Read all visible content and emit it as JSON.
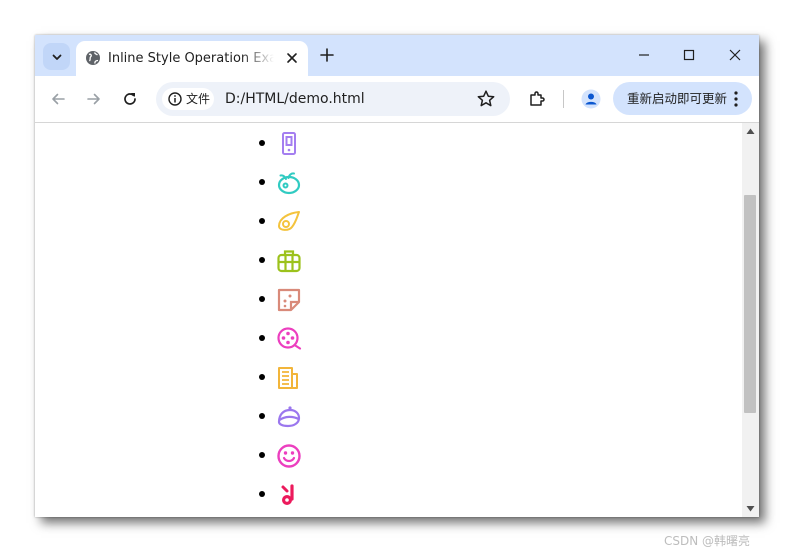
{
  "browser": {
    "tab": {
      "title": "Inline Style Operation Example"
    },
    "address": {
      "scheme_chip": "文件",
      "url": "D:/HTML/demo.html"
    },
    "update_button": {
      "label": "重新启动即可更新"
    }
  },
  "page": {
    "list_items": [
      {
        "icon": "phone-icon",
        "color": "#a47ef0"
      },
      {
        "icon": "fruit-icon",
        "color": "#31cbc2"
      },
      {
        "icon": "egg-icon",
        "color": "#f4c33d"
      },
      {
        "icon": "backpack-icon",
        "color": "#9cc21c"
      },
      {
        "icon": "note-icon",
        "color": "#d98a7a"
      },
      {
        "icon": "film-reel-icon",
        "color": "#ec3fbf"
      },
      {
        "icon": "newspaper-icon",
        "color": "#f2b53a"
      },
      {
        "icon": "hat-icon",
        "color": "#9b77ee"
      },
      {
        "icon": "smiley-icon",
        "color": "#ec3fbf"
      },
      {
        "icon": "music-note-icon",
        "color": "#ec1a5c"
      }
    ]
  },
  "watermark": {
    "text": "CSDN @韩曙亮"
  }
}
